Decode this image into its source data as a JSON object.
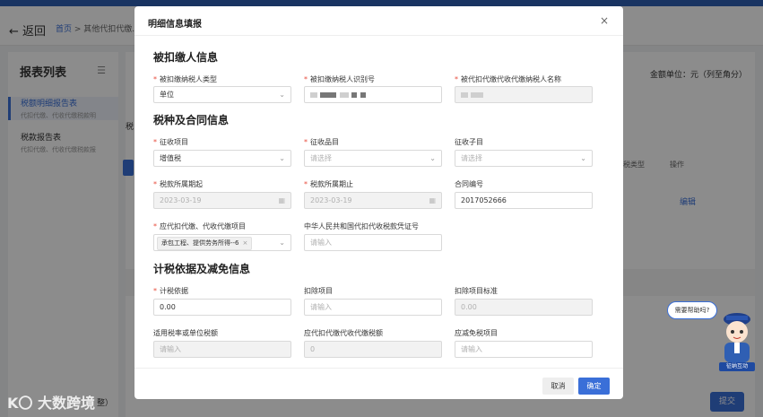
{
  "page": {
    "back_label": "返回",
    "breadcrumb_home": "首页",
    "breadcrumb_current": "其他代扣代缴...",
    "amount_unit": "金额单位：元（列至角分）",
    "table_tax_type_header": "税类型",
    "table_action_header": "操作",
    "edit_label": "编辑",
    "submit_label": "提交",
    "footer_fragment": "整）",
    "left_fragment": "税"
  },
  "sidebar": {
    "title": "报表列表",
    "items": [
      {
        "title": "税额明细报告表",
        "desc": "代扣代缴、代收代缴税款明",
        "active": true
      },
      {
        "title": "税款报告表",
        "desc": "代扣代缴、代收代缴税款报",
        "active": false
      }
    ]
  },
  "brand": "大数跨境",
  "help": {
    "bubble": "需要帮助吗?",
    "mascot_label": "征纳互动"
  },
  "modal": {
    "title": "明细信息填报",
    "close": "×",
    "sections": {
      "payer": "被扣缴人信息",
      "tax": "税种及合同信息",
      "basis": "计税依据及减免信息"
    },
    "fields": {
      "payer_type_label": "被扣缴纳税人类型",
      "payer_type_value": "单位",
      "payer_id_label": "被扣缴纳税人识别号",
      "payer_name_label": "被代扣代缴代收代缴纳税人名称",
      "levy_item_label": "征收项目",
      "levy_item_value": "增值税",
      "levy_product_label": "征收品目",
      "levy_product_placeholder": "请选择",
      "levy_subitem_label": "征收子目",
      "levy_subitem_placeholder": "请选择",
      "period_start_label": "税款所属期起",
      "period_start_value": "2023-03-19",
      "period_end_label": "税款所属期止",
      "period_end_value": "2023-03-19",
      "contract_no_label": "合同编号",
      "contract_no_value": "2017052666",
      "withholding_item_label": "应代扣代缴、代收代缴项目",
      "withholding_item_tag": "承包工程、提供劳务所得--6",
      "voucher_label": "中华人民共和国代扣代收税款凭证号",
      "voucher_placeholder": "请输入",
      "tax_basis_label": "计税依据",
      "tax_basis_value": "0.00",
      "deduct_item_label": "扣除项目",
      "deduct_item_placeholder": "请输入",
      "deduct_std_label": "扣除项目标准",
      "deduct_std_value": "0.00",
      "rate_label": "适用税率或单位税额",
      "rate_placeholder": "请输入",
      "payable_label": "应代扣代缴代收代缴税额",
      "payable_value": "0",
      "exempt_label": "应减免税项目",
      "exempt_placeholder": "请输入"
    },
    "cancel": "取消",
    "confirm": "确定"
  },
  "colors": {
    "accent": "#3a6fd8",
    "required": "#e74c3c",
    "header": "#2f5fb3"
  }
}
